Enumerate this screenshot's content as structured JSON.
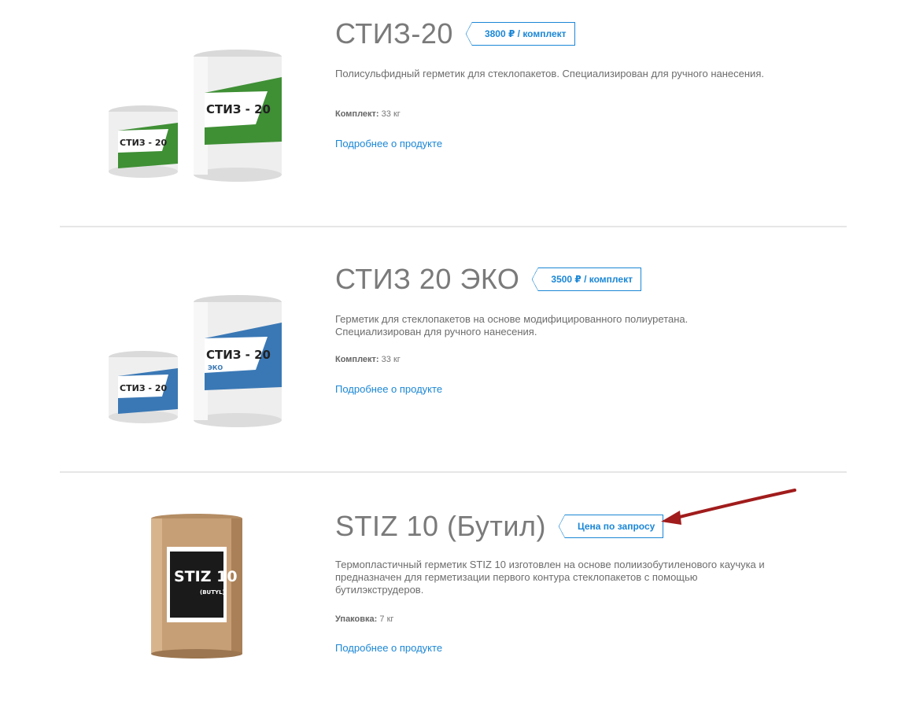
{
  "products": [
    {
      "title": "СТИЗ-20",
      "price": "3800 ₽ / комплект",
      "description": "Полисульфидный герметик для стеклопакетов. Специализирован для ручного нанесения.",
      "spec_label": "Комплект:",
      "spec_value": "33 кг",
      "link": "Подробнее о продукте",
      "image_label_big": "СТИЗ - 20",
      "image_label_small": "СТИЗ - 20",
      "accent": "#3f8f35"
    },
    {
      "title": "СТИЗ 20 ЭКО",
      "price": "3500 ₽ / комплект",
      "description": "Герметик для стеклопакетов на основе модифицированного полиуретана. Специализирован для ручного нанесения.",
      "spec_label": "Комплект:",
      "spec_value": "33 кг",
      "link": "Подробнее о продукте",
      "image_label_big": "СТИЗ - 20",
      "image_label_small": "СТИЗ - 20",
      "image_badge": "ЭКО",
      "accent": "#3a78b5"
    },
    {
      "title": "STIZ 10 (Бутил)",
      "price": "Цена по запросу",
      "description": "Термопластичный герметик STIZ 10 изготовлен на основе полиизобутиленового каучука и предназначен для герметизации первого контура стеклопакетов с помощью бутилэкструдеров.",
      "spec_label": "Упаковка:",
      "spec_value": "7 кг",
      "link": "Подробнее о продукте",
      "image_label": "STIZ 10",
      "image_sub": "(BUTYL)"
    }
  ],
  "annotation": {
    "arrow_color": "#a11c1c",
    "icon": "red-arrow-pointer"
  }
}
